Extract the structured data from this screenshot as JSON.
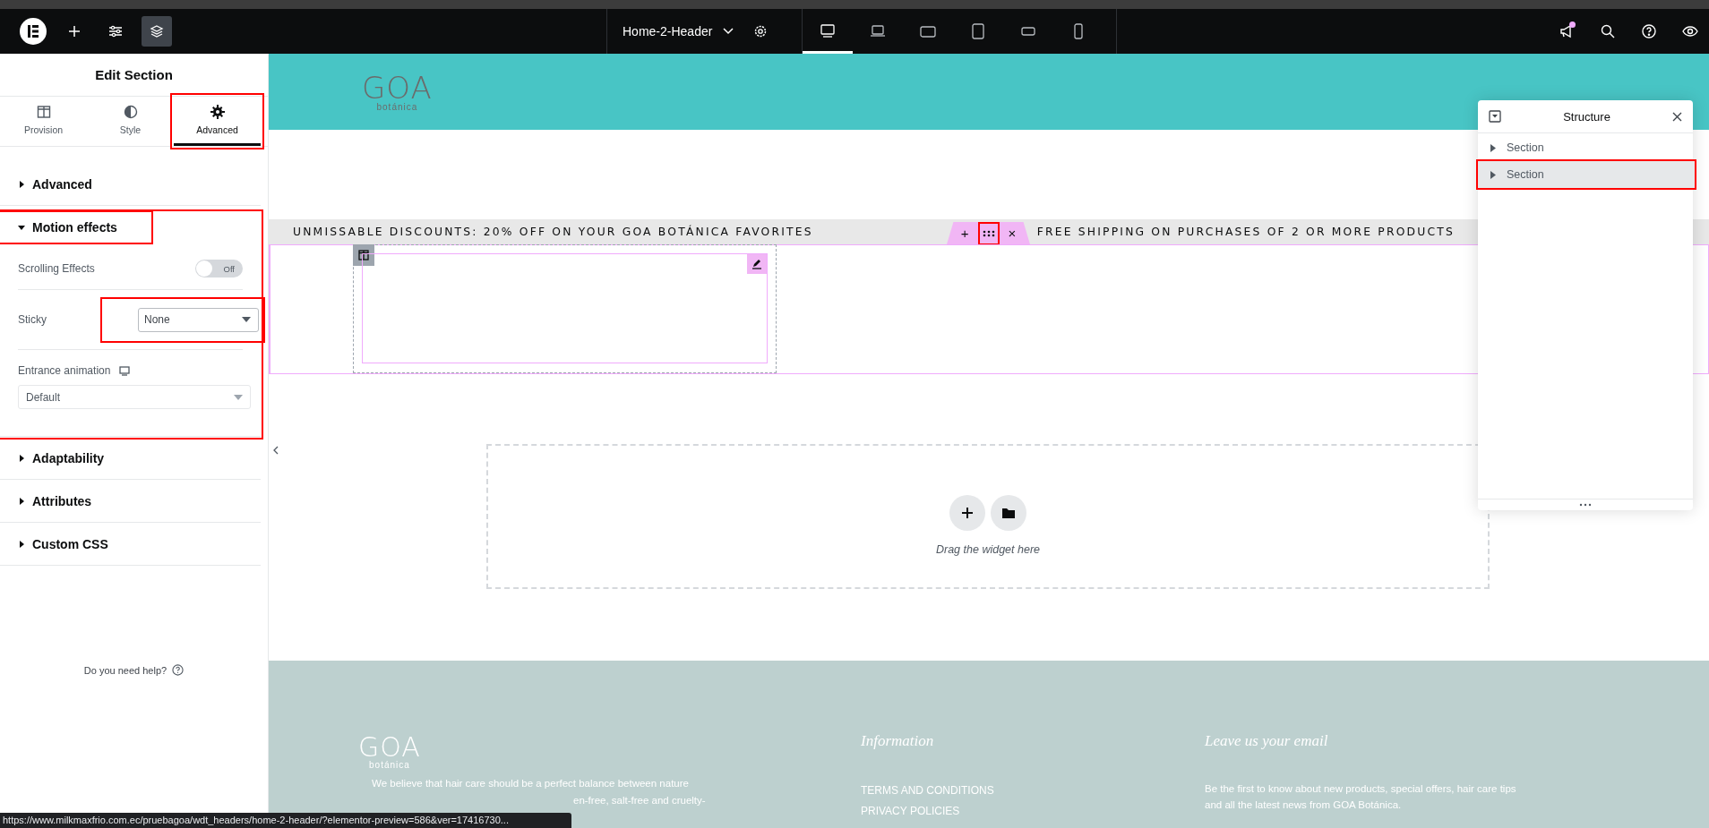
{
  "topbar": {
    "tools": [
      {
        "kind": "logo",
        "selected": false
      },
      {
        "kind": "add",
        "selected": false
      },
      {
        "kind": "settings",
        "selected": false
      },
      {
        "kind": "layers",
        "selected": true
      }
    ],
    "page_title": "Home-2-Header",
    "devices": [
      {
        "kind": "desktop",
        "selected": true
      },
      {
        "kind": "laptop",
        "selected": false
      },
      {
        "kind": "tablet-landscape",
        "selected": false
      },
      {
        "kind": "tablet",
        "selected": false
      },
      {
        "kind": "mobile-landscape",
        "selected": false
      },
      {
        "kind": "mobile",
        "selected": false
      }
    ],
    "actions": [
      {
        "kind": "announcements",
        "badge": true
      },
      {
        "kind": "search",
        "badge": false
      },
      {
        "kind": "help",
        "badge": false
      },
      {
        "kind": "preview",
        "badge": false
      }
    ]
  },
  "panel": {
    "title": "Edit Section",
    "tabs": [
      {
        "label": "Provision",
        "kind": "columns",
        "selected": false,
        "annotated": false
      },
      {
        "label": "Style",
        "kind": "contrast",
        "selected": false,
        "annotated": false
      },
      {
        "label": "Advanced",
        "kind": "gear",
        "selected": true,
        "annotated": true
      }
    ],
    "sections": [
      {
        "title": "Advanced",
        "expanded": false,
        "annotated": false,
        "title_annotated": false
      },
      {
        "title": "Motion effects",
        "expanded": true,
        "annotated": true,
        "title_annotated": true,
        "controls": [
          {
            "kind": "switch",
            "label": "Scrolling Effects",
            "on": false,
            "state_text": "Off"
          },
          {
            "kind": "select",
            "label": "Sticky",
            "value": "None",
            "annotated": true
          },
          {
            "kind": "select-block",
            "label": "Entrance animation",
            "value": "Default",
            "responsive": true
          }
        ]
      },
      {
        "title": "Adaptability",
        "expanded": false,
        "annotated": false,
        "title_annotated": false
      },
      {
        "title": "Attributes",
        "expanded": false,
        "annotated": false,
        "title_annotated": false
      },
      {
        "title": "Custom CSS",
        "expanded": false,
        "annotated": false,
        "title_annotated": false
      }
    ],
    "help": "Do you need help?"
  },
  "canvas": {
    "logo": {
      "word": "GOA",
      "sub": "botánica"
    },
    "marquee": [
      "UNMISSABLE DISCOUNTS: 20% OFF ON YOUR GOA BOTÁNICA FAVORITES",
      "FREE SHIPPING ON PURCHASES OF 2 OR MORE PRODUCTS"
    ],
    "handle": {
      "add": "+",
      "close": "×",
      "annotated": true
    },
    "drop_text": "Drag the widget here",
    "footer": {
      "logo": {
        "word": "GOA",
        "sub": "botánica"
      },
      "description": [
        "We believe that hair care should be a perfect balance between nature",
        "en-free, salt-free and cruelty-"
      ],
      "info_title": "Information",
      "links": [
        "TERMS AND CONDITIONS",
        "PRIVACY POLICIES"
      ],
      "email_title": "Leave us your email",
      "email_text": [
        "Be the first to know about new products, special offers, hair care tips",
        "and all the latest news from GOA Botánica."
      ]
    }
  },
  "structure": {
    "title": "Structure",
    "items": [
      {
        "label": "Section",
        "selected": false,
        "annotated": false
      },
      {
        "label": "Section",
        "selected": true,
        "annotated": true
      }
    ]
  },
  "status_url": "https://www.milkmaxfrio.com.ec/pruebagoa/wdt_headers/home-2-header/?elementor-preview=586&ver=17416730..."
}
